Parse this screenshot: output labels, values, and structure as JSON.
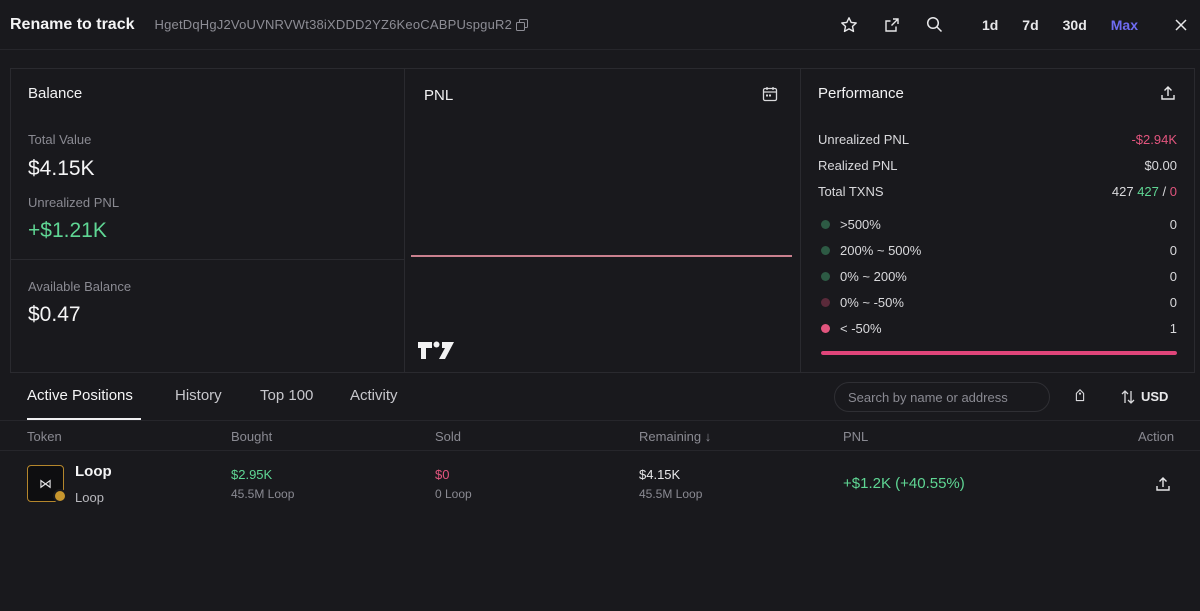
{
  "header": {
    "title": "Rename to track",
    "address": "HgetDqHgJ2VoUVNRVWt38iXDDD2YZ6KeoCABPUspguR2",
    "ranges": [
      "1d",
      "7d",
      "30d",
      "Max"
    ],
    "active_range": "Max"
  },
  "balance": {
    "title": "Balance",
    "total_value_label": "Total Value",
    "total_value": "$4.15K",
    "unrealized_label": "Unrealized PNL",
    "unrealized_value": "+$1.21K",
    "available_label": "Available Balance",
    "available_value": "$0.47"
  },
  "pnl": {
    "title": "PNL"
  },
  "performance": {
    "title": "Performance",
    "rows": [
      {
        "label": "Unrealized PNL",
        "value": "-$2.94K"
      },
      {
        "label": "Realized PNL",
        "value": "$0.00"
      }
    ],
    "txns": {
      "label": "Total TXNS",
      "total": "427",
      "buys": "427",
      "sep": "/",
      "sells": "0"
    },
    "buckets": [
      {
        "label": ">500%",
        "count": "0",
        "color": "#2d5a44"
      },
      {
        "label": "200% ~ 500%",
        "count": "0",
        "color": "#2d5a44"
      },
      {
        "label": "0% ~ 200%",
        "count": "0",
        "color": "#2d5a44"
      },
      {
        "label": "0% ~ -50%",
        "count": "0",
        "color": "#5a2a3a"
      },
      {
        "label": "< -50%",
        "count": "1",
        "color": "#e2557e"
      }
    ],
    "bar_fill_fraction": 1.0
  },
  "tabs": {
    "items": [
      "Active Positions",
      "History",
      "Top 100",
      "Activity"
    ],
    "active": "Active Positions",
    "search_placeholder": "Search by name or address",
    "currency": "USD"
  },
  "table": {
    "headers": [
      "Token",
      "Bought",
      "Sold",
      "Remaining ↓",
      "PNL",
      "Action"
    ],
    "rows": [
      {
        "token_name": "Loop",
        "token_symbol": "Loop",
        "token_glyph": "⋈",
        "bought": "$2.95K",
        "bought_sub": "45.5M Loop",
        "sold": "$0",
        "sold_sub": "0 Loop",
        "remaining": "$4.15K",
        "remaining_sub": "45.5M Loop",
        "pnl": "+$1.2K (+40.55%)"
      }
    ]
  },
  "colors": {
    "accent": "#6f6cf2",
    "positive": "#5fd694",
    "negative": "#e2557e",
    "background": "#19191d"
  }
}
